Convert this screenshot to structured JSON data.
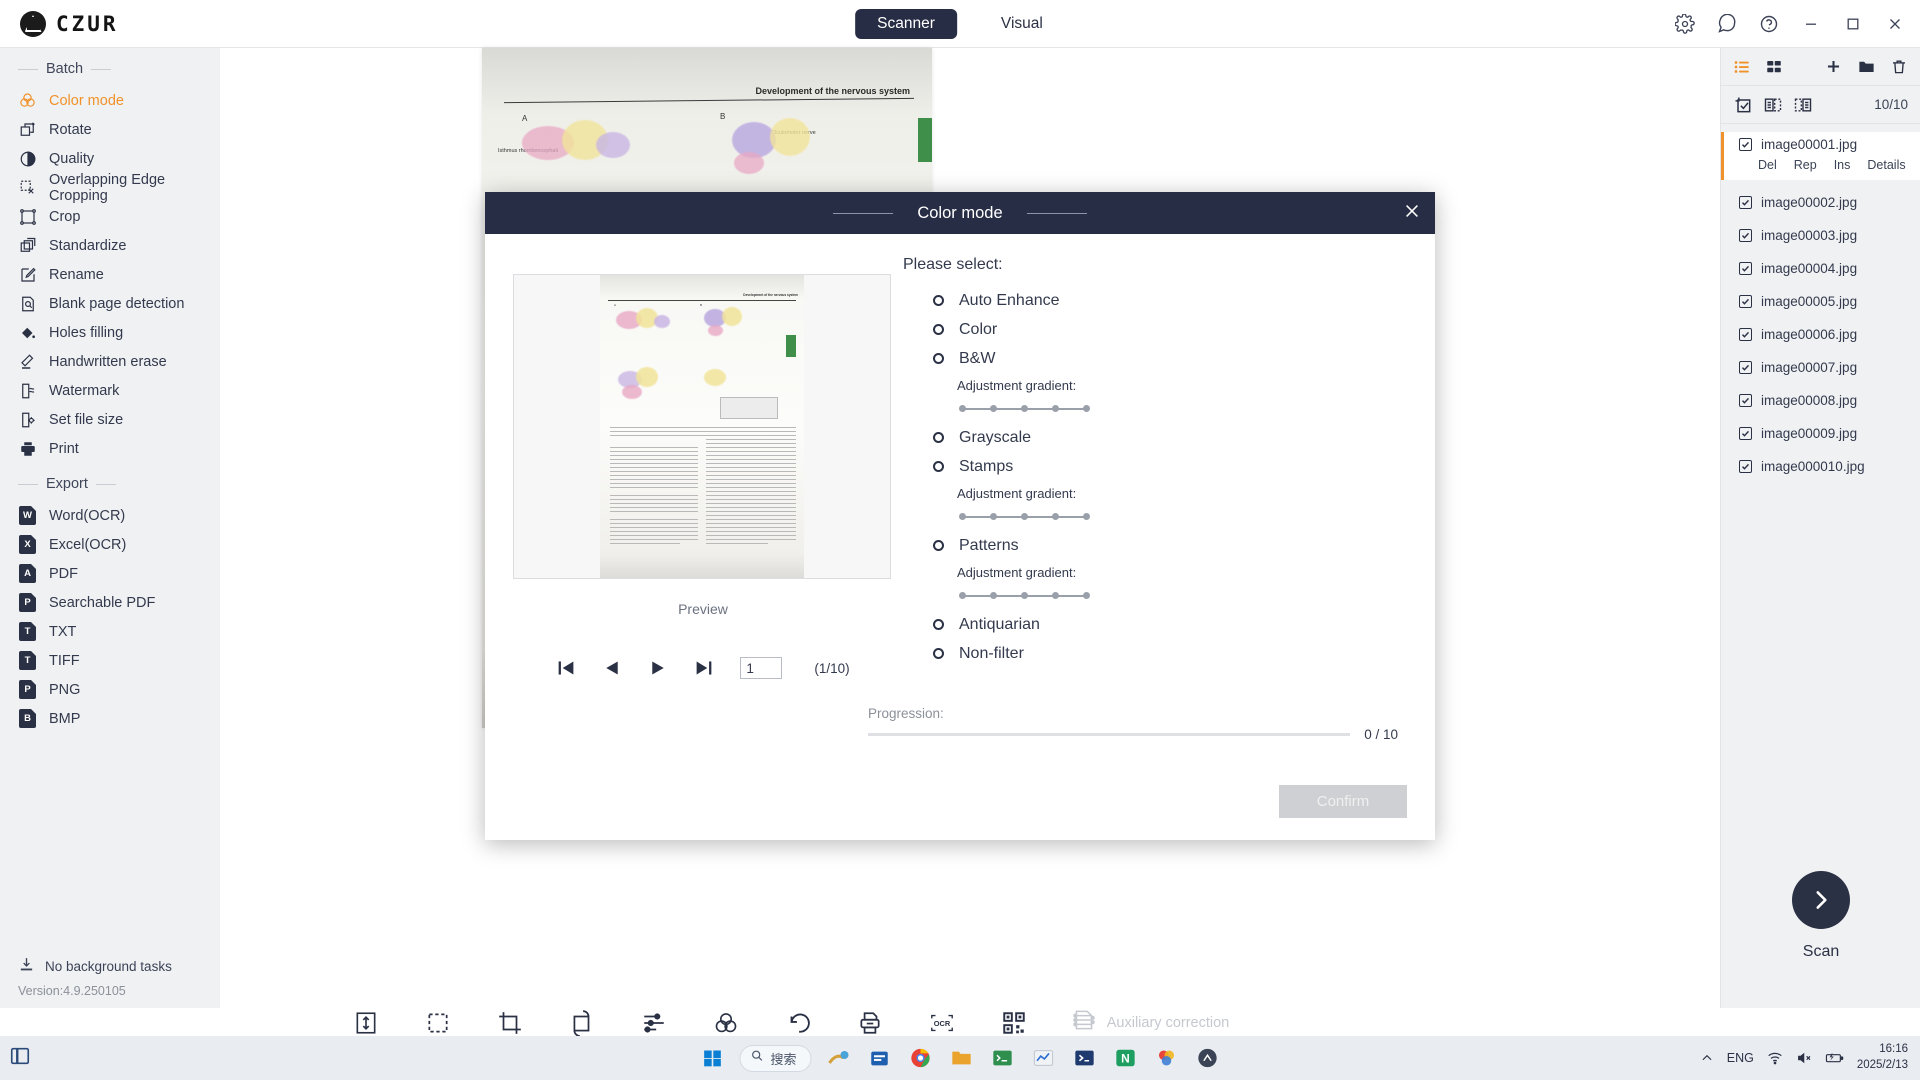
{
  "app": {
    "brand": "CZUR",
    "logo_icon": "czur-logo-icon",
    "version": "Version:4.9.250105",
    "background_status": "No background tasks"
  },
  "titlebar": {
    "tabs": [
      {
        "label": "Scanner",
        "active": true
      },
      {
        "label": "Visual",
        "active": false
      }
    ],
    "controls": [
      {
        "name": "settings-icon",
        "label": "Settings"
      },
      {
        "name": "feedback-icon",
        "label": "Feedback"
      },
      {
        "name": "help-icon",
        "label": "Help"
      },
      {
        "name": "minimize-icon",
        "label": "Minimize"
      },
      {
        "name": "maximize-icon",
        "label": "Maximize"
      },
      {
        "name": "close-icon",
        "label": "Close"
      }
    ]
  },
  "sidebar": {
    "sections": [
      {
        "title": "Batch",
        "items": [
          {
            "label": "Color mode",
            "icon": "color-mode-icon",
            "active": true
          },
          {
            "label": "Rotate",
            "icon": "rotate-icon",
            "active": false
          },
          {
            "label": "Quality",
            "icon": "quality-icon",
            "active": false
          },
          {
            "label": "Overlapping Edge Cropping",
            "icon": "overlap-crop-icon",
            "active": false
          },
          {
            "label": "Crop",
            "icon": "crop-icon",
            "active": false
          },
          {
            "label": "Standardize",
            "icon": "standardize-icon",
            "active": false
          },
          {
            "label": "Rename",
            "icon": "rename-icon",
            "active": false
          },
          {
            "label": "Blank page detection",
            "icon": "blank-page-icon",
            "active": false
          },
          {
            "label": "Holes filling",
            "icon": "holes-filling-icon",
            "active": false
          },
          {
            "label": "Handwritten erase",
            "icon": "handwritten-erase-icon",
            "active": false
          },
          {
            "label": "Watermark",
            "icon": "watermark-icon",
            "active": false
          },
          {
            "label": "Set file size",
            "icon": "set-file-size-icon",
            "active": false
          },
          {
            "label": "Print",
            "icon": "print-icon",
            "active": false
          }
        ]
      },
      {
        "title": "Export",
        "items": [
          {
            "label": "Word(OCR)",
            "icon": "word-icon",
            "badge": "W",
            "active": false
          },
          {
            "label": "Excel(OCR)",
            "icon": "excel-icon",
            "badge": "X",
            "active": false
          },
          {
            "label": "PDF",
            "icon": "pdf-icon",
            "badge": "A",
            "active": false
          },
          {
            "label": "Searchable PDF",
            "icon": "searchable-pdf-icon",
            "badge": "P",
            "active": false
          },
          {
            "label": "TXT",
            "icon": "txt-icon",
            "badge": "T",
            "active": false
          },
          {
            "label": "TIFF",
            "icon": "tiff-icon",
            "badge": "T",
            "active": false
          },
          {
            "label": "PNG",
            "icon": "png-icon",
            "badge": "P",
            "active": false
          },
          {
            "label": "BMP",
            "icon": "bmp-icon",
            "badge": "B",
            "active": false
          }
        ]
      }
    ]
  },
  "canvas": {
    "document_title": "Development of the nervous system",
    "labels": [
      "A",
      "B",
      "Isthmus rhombencephali",
      "Oculomotor nerve"
    ]
  },
  "toolbar": {
    "tools": [
      {
        "name": "fit-height-icon",
        "label": "Fit height",
        "disabled": false
      },
      {
        "name": "selection-icon",
        "label": "Selection",
        "disabled": false
      },
      {
        "name": "crop-icon",
        "label": "Crop",
        "disabled": false
      },
      {
        "name": "rotate-icon",
        "label": "Rotate",
        "disabled": false
      },
      {
        "name": "adjust-icon",
        "label": "Adjust",
        "disabled": false
      },
      {
        "name": "color-mode-icon",
        "label": "Color mode",
        "disabled": false
      },
      {
        "name": "undo-icon",
        "label": "Undo",
        "disabled": false
      },
      {
        "name": "print-icon",
        "label": "Print",
        "disabled": false
      },
      {
        "name": "ocr-icon",
        "label": "OCR",
        "disabled": false
      },
      {
        "name": "qrcode-icon",
        "label": "QR code",
        "disabled": false
      }
    ],
    "auxiliary": {
      "label": "Auxiliary correction",
      "icon": "auxiliary-correction-icon",
      "disabled": true
    }
  },
  "right_panel": {
    "view_icons": [
      {
        "name": "list-view-icon",
        "active": true
      },
      {
        "name": "grid-view-icon",
        "active": false
      }
    ],
    "action_icons": [
      {
        "name": "add-icon"
      },
      {
        "name": "folder-icon"
      },
      {
        "name": "delete-icon"
      }
    ],
    "select_icons": [
      {
        "name": "select-all-icon"
      },
      {
        "name": "select-odd-icon"
      },
      {
        "name": "select-even-icon"
      }
    ],
    "count": "10/10",
    "selected_actions": [
      "Del",
      "Rep",
      "Ins",
      "Details"
    ],
    "files": [
      {
        "name": "image00001.jpg",
        "checked": true,
        "selected": true
      },
      {
        "name": "image00002.jpg",
        "checked": true,
        "selected": false
      },
      {
        "name": "image00003.jpg",
        "checked": true,
        "selected": false
      },
      {
        "name": "image00004.jpg",
        "checked": true,
        "selected": false
      },
      {
        "name": "image00005.jpg",
        "checked": true,
        "selected": false
      },
      {
        "name": "image00006.jpg",
        "checked": true,
        "selected": false
      },
      {
        "name": "image00007.jpg",
        "checked": true,
        "selected": false
      },
      {
        "name": "image00008.jpg",
        "checked": true,
        "selected": false
      },
      {
        "name": "image00009.jpg",
        "checked": true,
        "selected": false
      },
      {
        "name": "image000010.jpg",
        "checked": true,
        "selected": false
      }
    ],
    "scan": {
      "label": "Scan",
      "icon": "scan-arrow-icon"
    }
  },
  "modal": {
    "title": "Color mode",
    "close_icon": "close-icon",
    "prompt": "Please select:",
    "preview_label": "Preview",
    "options": [
      {
        "label": "Auto Enhance",
        "selected": false,
        "has_slider": false
      },
      {
        "label": "Color",
        "selected": false,
        "has_slider": false
      },
      {
        "label": "B&W",
        "selected": false,
        "has_slider": true,
        "slider_label": "Adjustment gradient:",
        "slider_value": 2,
        "slider_steps": 5
      },
      {
        "label": "Grayscale",
        "selected": false,
        "has_slider": false
      },
      {
        "label": "Stamps",
        "selected": false,
        "has_slider": true,
        "slider_label": "Adjustment gradient:",
        "slider_value": 2,
        "slider_steps": 5
      },
      {
        "label": "Patterns",
        "selected": false,
        "has_slider": true,
        "slider_label": "Adjustment gradient:",
        "slider_value": 2,
        "slider_steps": 5
      },
      {
        "label": "Antiquarian",
        "selected": false,
        "has_slider": false
      },
      {
        "label": "Non-filter",
        "selected": false,
        "has_slider": false
      }
    ],
    "pager": {
      "first_icon": "first-page-icon",
      "prev_icon": "prev-page-icon",
      "next_icon": "next-page-icon",
      "last_icon": "last-page-icon",
      "page_value": "1",
      "page_count": "(1/10)"
    },
    "progress": {
      "label": "Progression:",
      "percent": 0,
      "text": "0 / 10"
    },
    "confirm_label": "Confirm"
  },
  "taskbar": {
    "start_icon": "windows-start-icon",
    "search_placeholder": "搜索",
    "search_icon": "search-icon",
    "apps": [
      {
        "name": "taskbar-app-paint-icon"
      },
      {
        "name": "taskbar-app-store-icon"
      },
      {
        "name": "taskbar-app-chrome-icon"
      },
      {
        "name": "taskbar-app-explorer-icon"
      },
      {
        "name": "taskbar-app-terminal-icon"
      },
      {
        "name": "taskbar-app-charts-icon"
      },
      {
        "name": "taskbar-app-powershell-icon"
      },
      {
        "name": "taskbar-app-n-icon"
      },
      {
        "name": "taskbar-app-colors-icon"
      },
      {
        "name": "taskbar-app-czur-icon"
      }
    ],
    "tray": {
      "chevron_icon": "chevron-up-icon",
      "language": "ENG",
      "wifi_icon": "wifi-icon",
      "volume_icon": "volume-muted-icon",
      "battery_icon": "battery-charging-icon",
      "time": "16:16",
      "date": "2025/2/13"
    }
  }
}
